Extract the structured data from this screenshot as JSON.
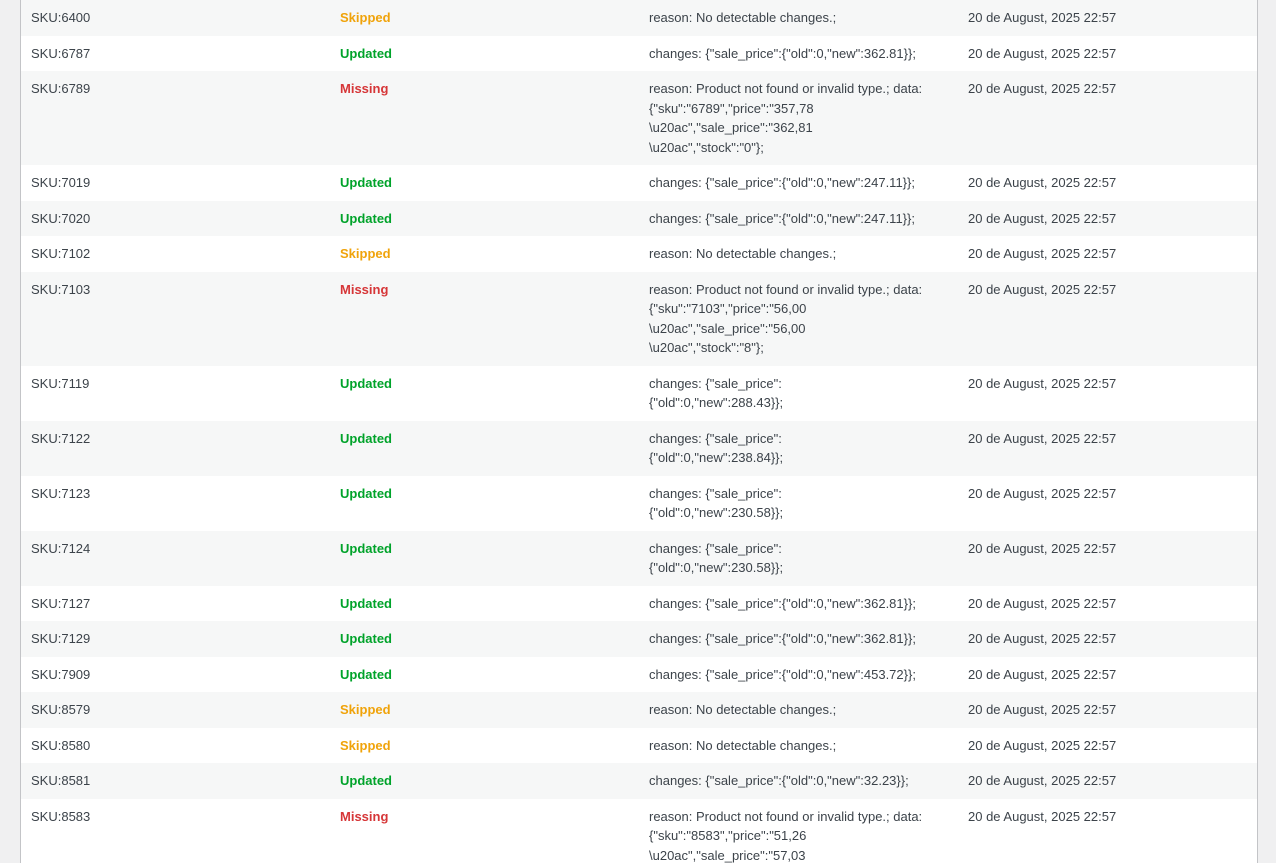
{
  "colors": {
    "updated": "#00a32a",
    "skipped": "#f0a30a",
    "missing": "#d63638",
    "text": "#3c434a",
    "row_alt": "#f6f7f7"
  },
  "rows": [
    {
      "sku": "SKU:6400",
      "status": "Skipped",
      "status_key": "skipped",
      "details": "reason: No detectable changes.;",
      "date": "20 de August, 2025 22:57"
    },
    {
      "sku": "SKU:6787",
      "status": "Updated",
      "status_key": "updated",
      "details": "changes: {\"sale_price\":{\"old\":0,\"new\":362.81}};",
      "date": "20 de August, 2025 22:57"
    },
    {
      "sku": "SKU:6789",
      "status": "Missing",
      "status_key": "missing",
      "details": "reason: Product not found or invalid type.; data:\n{\"sku\":\"6789\",\"price\":\"357,78\n\\u20ac\",\"sale_price\":\"362,81\n\\u20ac\",\"stock\":\"0\"};",
      "date": "20 de August, 2025 22:57"
    },
    {
      "sku": "SKU:7019",
      "status": "Updated",
      "status_key": "updated",
      "details": "changes: {\"sale_price\":{\"old\":0,\"new\":247.11}};",
      "date": "20 de August, 2025 22:57"
    },
    {
      "sku": "SKU:7020",
      "status": "Updated",
      "status_key": "updated",
      "details": "changes: {\"sale_price\":{\"old\":0,\"new\":247.11}};",
      "date": "20 de August, 2025 22:57"
    },
    {
      "sku": "SKU:7102",
      "status": "Skipped",
      "status_key": "skipped",
      "details": "reason: No detectable changes.;",
      "date": "20 de August, 2025 22:57"
    },
    {
      "sku": "SKU:7103",
      "status": "Missing",
      "status_key": "missing",
      "details": "reason: Product not found or invalid type.; data:\n{\"sku\":\"7103\",\"price\":\"56,00\n\\u20ac\",\"sale_price\":\"56,00\n\\u20ac\",\"stock\":\"8\"};",
      "date": "20 de August, 2025 22:57"
    },
    {
      "sku": "SKU:7119",
      "status": "Updated",
      "status_key": "updated",
      "details": "changes: {\"sale_price\":\n{\"old\":0,\"new\":288.43}};",
      "date": "20 de August, 2025 22:57"
    },
    {
      "sku": "SKU:7122",
      "status": "Updated",
      "status_key": "updated",
      "details": "changes: {\"sale_price\":\n{\"old\":0,\"new\":238.84}};",
      "date": "20 de August, 2025 22:57"
    },
    {
      "sku": "SKU:7123",
      "status": "Updated",
      "status_key": "updated",
      "details": "changes: {\"sale_price\":\n{\"old\":0,\"new\":230.58}};",
      "date": "20 de August, 2025 22:57"
    },
    {
      "sku": "SKU:7124",
      "status": "Updated",
      "status_key": "updated",
      "details": "changes: {\"sale_price\":\n{\"old\":0,\"new\":230.58}};",
      "date": "20 de August, 2025 22:57"
    },
    {
      "sku": "SKU:7127",
      "status": "Updated",
      "status_key": "updated",
      "details": "changes: {\"sale_price\":{\"old\":0,\"new\":362.81}};",
      "date": "20 de August, 2025 22:57"
    },
    {
      "sku": "SKU:7129",
      "status": "Updated",
      "status_key": "updated",
      "details": "changes: {\"sale_price\":{\"old\":0,\"new\":362.81}};",
      "date": "20 de August, 2025 22:57"
    },
    {
      "sku": "SKU:7909",
      "status": "Updated",
      "status_key": "updated",
      "details": "changes: {\"sale_price\":{\"old\":0,\"new\":453.72}};",
      "date": "20 de August, 2025 22:57"
    },
    {
      "sku": "SKU:8579",
      "status": "Skipped",
      "status_key": "skipped",
      "details": "reason: No detectable changes.;",
      "date": "20 de August, 2025 22:57"
    },
    {
      "sku": "SKU:8580",
      "status": "Skipped",
      "status_key": "skipped",
      "details": "reason: No detectable changes.;",
      "date": "20 de August, 2025 22:57"
    },
    {
      "sku": "SKU:8581",
      "status": "Updated",
      "status_key": "updated",
      "details": "changes: {\"sale_price\":{\"old\":0,\"new\":32.23}};",
      "date": "20 de August, 2025 22:57"
    },
    {
      "sku": "SKU:8583",
      "status": "Missing",
      "status_key": "missing",
      "details": "reason: Product not found or invalid type.; data:\n{\"sku\":\"8583\",\"price\":\"51,26\n\\u20ac\",\"sale_price\":\"57,03",
      "date": "20 de August, 2025 22:57"
    }
  ]
}
